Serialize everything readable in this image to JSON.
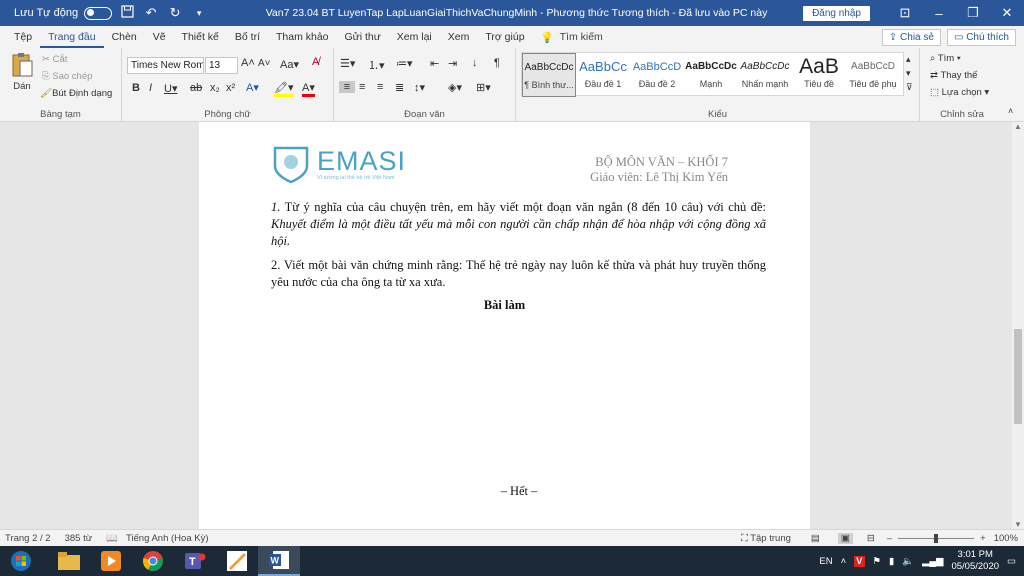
{
  "titlebar": {
    "autosave_label": "Lưu Tự động",
    "doc_title": "Van7 23.04 BT LuyenTap LapLuanGiaiThichVaChungMinh  -  Phương thức Tương thích  -  Đã lưu vào PC này",
    "signin": "Đăng nhập"
  },
  "tabs": [
    "Tệp",
    "Trang đầu",
    "Chèn",
    "Vẽ",
    "Thiết kế",
    "Bố trí",
    "Tham khảo",
    "Gửi thư",
    "Xem lại",
    "Xem",
    "Trợ giúp"
  ],
  "search": {
    "label": "Tìm kiếm"
  },
  "share_label": "Chia sẻ",
  "comment_label": "Chú thích",
  "ribbon": {
    "clipboard": {
      "paste": "Dán",
      "cut": "Cắt",
      "copy": "Sao chép",
      "format_painter": "Bút Định dạng",
      "label": "Bảng tạm"
    },
    "font": {
      "name": "Times New Rom",
      "size": "13",
      "label": "Phông chữ"
    },
    "paragraph": {
      "label": "Đoạn văn"
    },
    "styles": {
      "label": "Kiểu",
      "items": [
        {
          "preview": "AaBbCcDc",
          "name": "¶ Bình thư..."
        },
        {
          "preview": "AaBbCc",
          "name": "Đầu đề 1"
        },
        {
          "preview": "AaBbCcD",
          "name": "Đầu đề 2"
        },
        {
          "preview": "AaBbCcDc",
          "name": "Mạnh"
        },
        {
          "preview": "AaBbCcDc",
          "name": "Nhấn mạnh"
        },
        {
          "preview": "AaB",
          "name": "Tiêu đề"
        },
        {
          "preview": "AaBbCcD",
          "name": "Tiêu đề phụ"
        }
      ]
    },
    "editing": {
      "find": "Tìm",
      "replace": "Thay thế",
      "select": "Lựa chọn",
      "label": "Chỉnh sửa"
    }
  },
  "document": {
    "logo_text": "EMASI",
    "logo_tagline": "Vì tương lai thế hệ trẻ Việt Nam",
    "header_right_1": "BỘ MÔN VĂN – KHỐI 7",
    "header_right_2": "Giáo viên: Lê Thị Kim Yến",
    "q1_number": "1.",
    "q1_text": " Từ ý nghĩa của câu chuyện trên, em hãy viết một đoạn văn ngắn (8 đến 10 câu) với chủ đề: ",
    "q1_italic": "Khuyết điểm là một điều tất yếu mà mỗi con người cần chấp nhận để hòa nhập với cộng đồng xã hội.",
    "q2_text": "2. Viết một bài văn chứng minh rằng: Thế hệ trẻ ngày nay luôn kế thừa và phát huy truyền thống yêu nước của cha ông ta từ xa xưa.",
    "bai_lam": "Bài làm",
    "het": "– Hết –"
  },
  "status": {
    "page": "Trang 2 / 2",
    "words": "385 từ",
    "language": "Tiếng Anh (Hoa Kỳ)",
    "focus": "Tập trung",
    "zoom": "100%"
  },
  "taskbar": {
    "lang": "EN",
    "time": "3:01 PM",
    "date": "05/05/2020"
  },
  "colors": {
    "accent": "#2b579a",
    "logo": "#4aa3c7"
  }
}
